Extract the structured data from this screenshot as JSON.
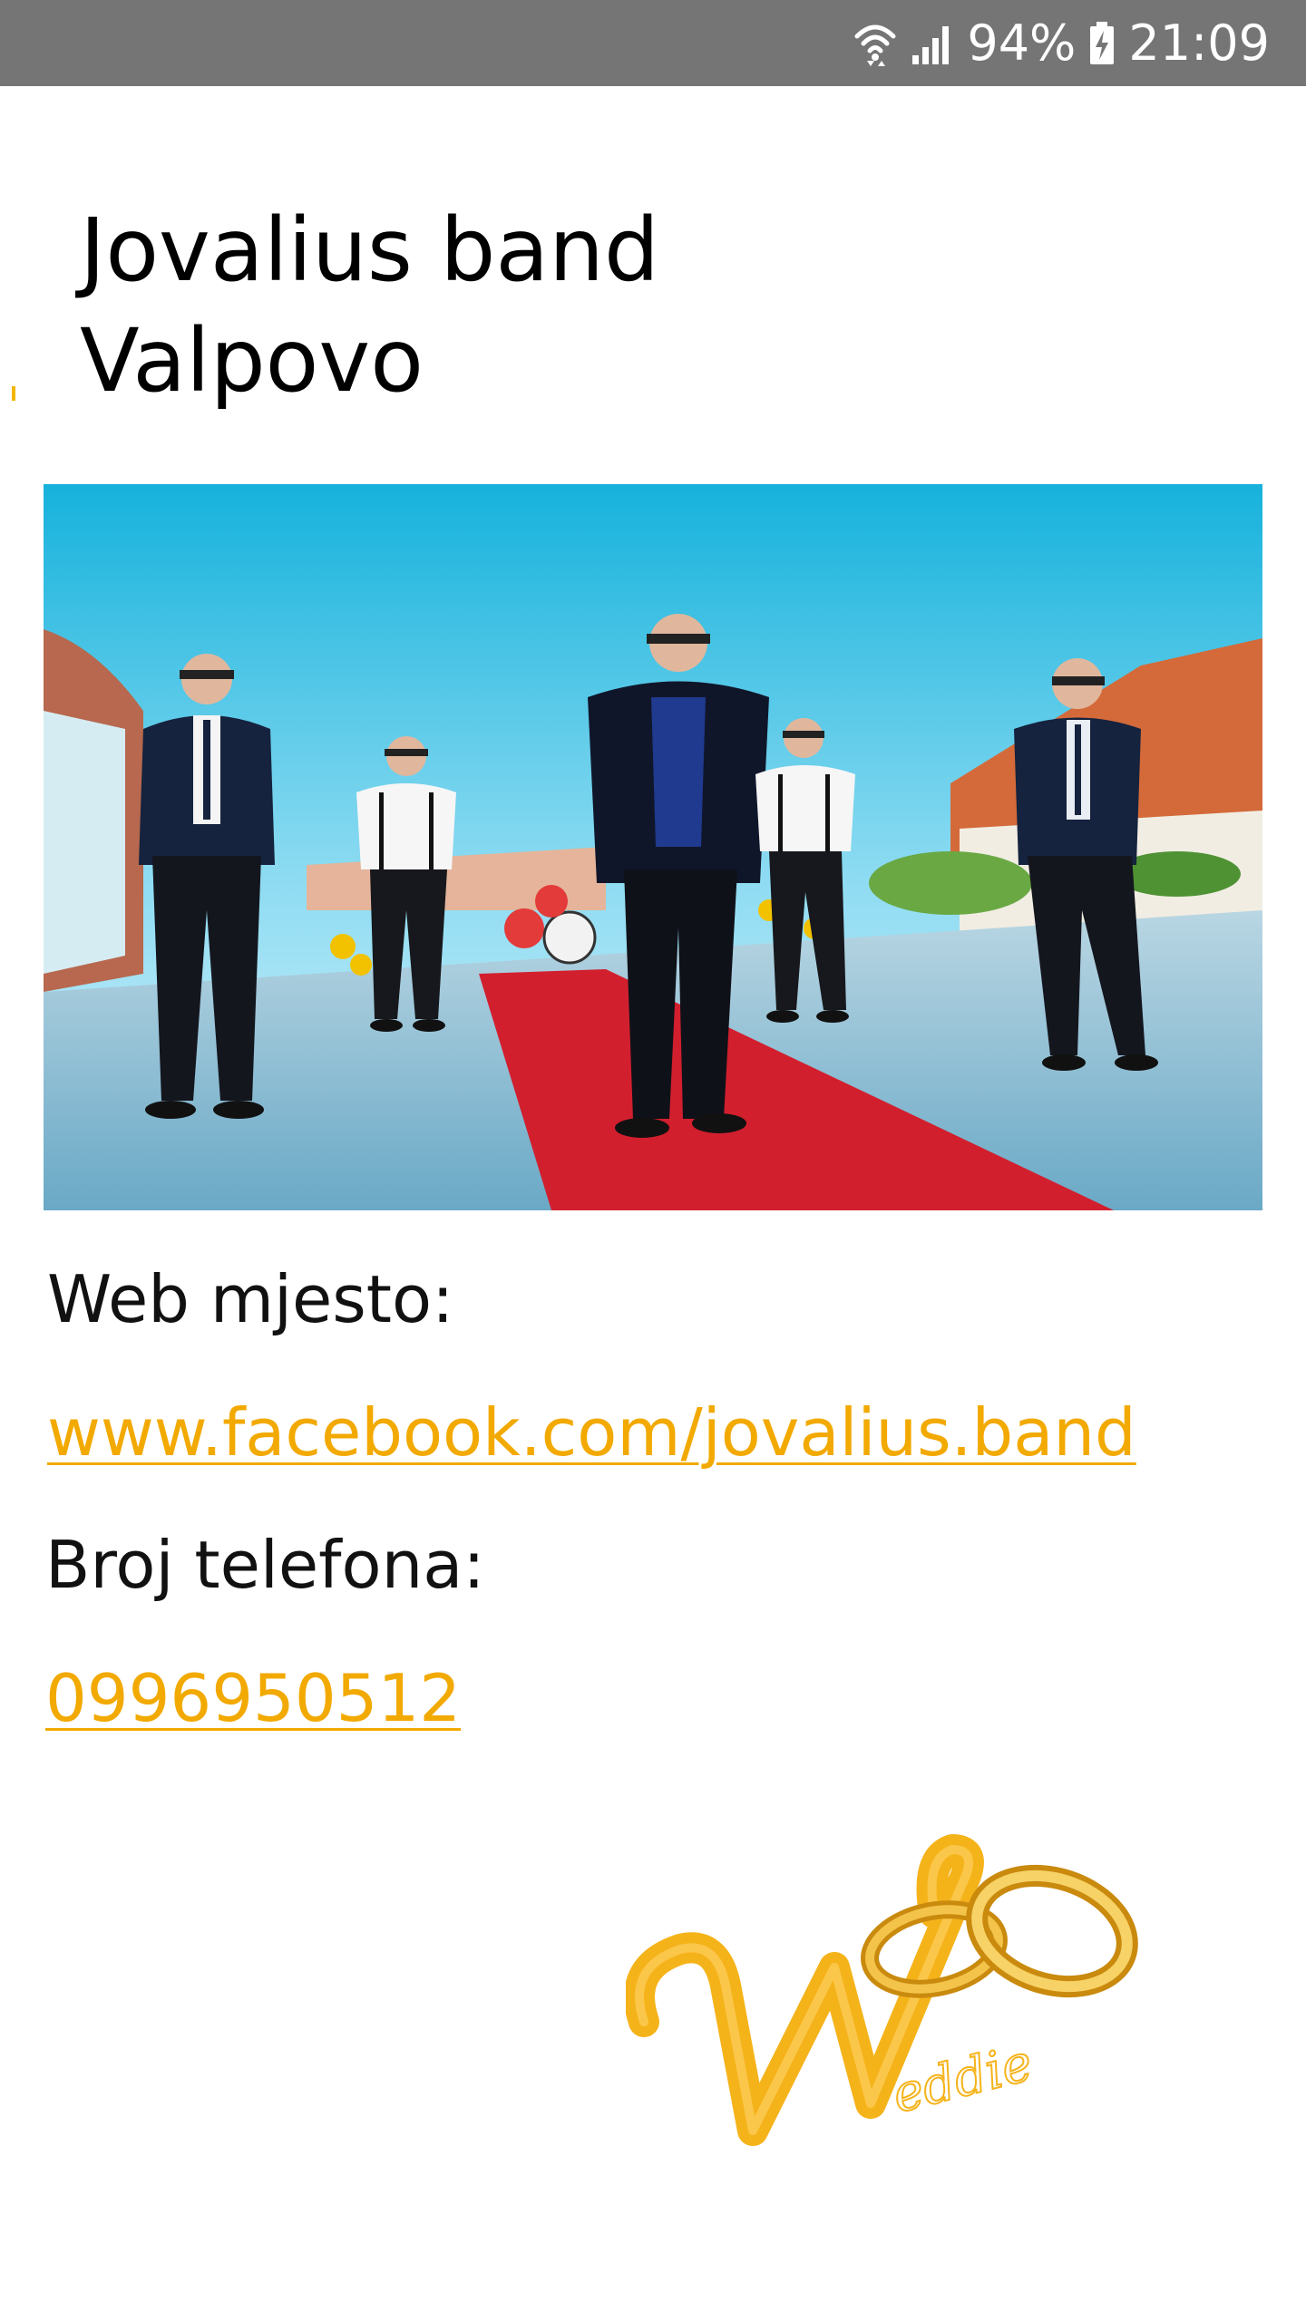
{
  "status_bar": {
    "battery": "94%",
    "time": "21:09"
  },
  "title": {
    "line1": "Jovalius band",
    "line2": "Valpovo"
  },
  "web": {
    "label": "Web mjesto:",
    "url": "www.facebook.com/jovalius.band"
  },
  "phone": {
    "label": "Broj telefona:",
    "number": "0996950512"
  },
  "logo": {
    "text": "eddie",
    "letter": "W"
  },
  "colors": {
    "status_bar_bg": "#757575",
    "link": "#f2a900",
    "logo_gold": "#f5b31a"
  }
}
